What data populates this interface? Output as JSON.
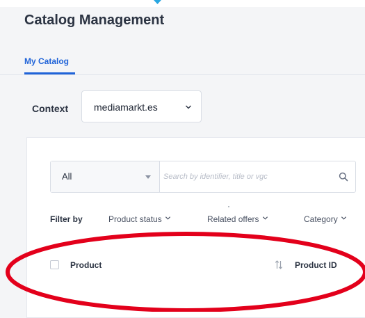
{
  "page": {
    "title": "Catalog Management"
  },
  "tabs": [
    {
      "label": "My Catalog",
      "active": true
    }
  ],
  "context": {
    "label": "Context",
    "value": "mediamarkt.es"
  },
  "search": {
    "scope_value": "All",
    "placeholder": "Search by identifier, title or vgc"
  },
  "filters": {
    "label": "Filter by",
    "items": [
      "Product status",
      "Related offers",
      "Category"
    ]
  },
  "table": {
    "columns": [
      "Product",
      "Product ID"
    ]
  },
  "icons": {
    "search": "search-icon",
    "chevron": "chevron-down-icon",
    "sort": "sort-icon",
    "caret": "caret-down-icon"
  },
  "colors": {
    "accent": "#1f63d8",
    "annotation": "#e3001b",
    "marker": "#29a7e1"
  }
}
